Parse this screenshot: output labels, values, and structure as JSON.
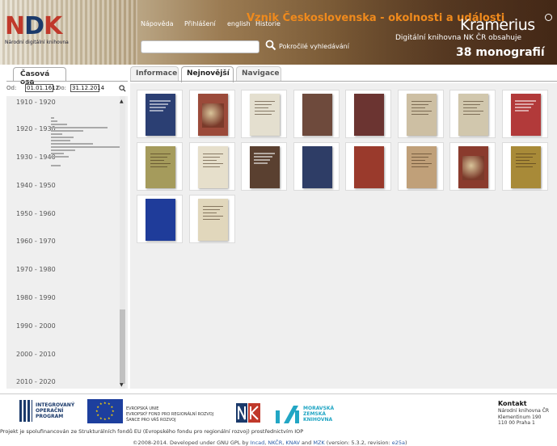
{
  "header": {
    "logo": {
      "mark_a": "N",
      "mark_b": "D",
      "mark_c": "K",
      "subtitle": "Národní digitální knihovna"
    },
    "links": {
      "help": "Nápověda",
      "login": "Přihlášení",
      "lang": "english",
      "history": "Historie"
    },
    "search": {
      "placeholder": "",
      "advanced": "Pokročilé vyhledávání"
    },
    "collection_title": "Vznik Československa - okolnosti a události",
    "app_name": "Kramerius",
    "library_contains": "Digitální knihovna NK ČR obsahuje",
    "monograph_count": "38 monografií"
  },
  "left": {
    "tab_label": "Časová osa",
    "date_from_label": "Od:",
    "date_from": "01.01.1612",
    "date_to_label": "Do:",
    "date_to": "31.12.2014",
    "decades": [
      "1910 - 1920",
      "1920 - 1930",
      "1930 - 1940",
      "1940 - 1950",
      "1950 - 1960",
      "1960 - 1970",
      "1970 - 1980",
      "1980 - 1990",
      "1990 - 2000",
      "2000 - 2010",
      "2010 - 2020"
    ]
  },
  "right": {
    "tabs": {
      "info": "Informace",
      "newest": "Nejnovější",
      "nav": "Navigace"
    },
    "active_tab": "Nejnovější",
    "covers": [
      {
        "color": "#2b3f73",
        "style": "title-light"
      },
      {
        "color": "#9b4a3a",
        "style": "picture"
      },
      {
        "color": "#e4dfcf",
        "style": "title-dark"
      },
      {
        "color": "#6e4a3c",
        "style": "plain"
      },
      {
        "color": "#6b3431",
        "style": "plain"
      },
      {
        "color": "#cdbfa3",
        "style": "title-dark"
      },
      {
        "color": "#d1c7ad",
        "style": "title-dark"
      },
      {
        "color": "#b23a3a",
        "style": "title-light"
      },
      {
        "color": "#a59b5c",
        "style": "title-dark"
      },
      {
        "color": "#e6dfcb",
        "style": "title-dark"
      },
      {
        "color": "#5a4030",
        "style": "title-light"
      },
      {
        "color": "#2e3d66",
        "style": "plain"
      },
      {
        "color": "#9a3a2c",
        "style": "plain"
      },
      {
        "color": "#c0a079",
        "style": "title-dark"
      },
      {
        "color": "#8a3b2d",
        "style": "picture"
      },
      {
        "color": "#a88a38",
        "style": "title-dark"
      },
      {
        "color": "#1f3c9a",
        "style": "plain"
      },
      {
        "color": "#e1d7bc",
        "style": "title-dark"
      }
    ]
  },
  "footer": {
    "eu_op": "INTEGROVANÝ OPERAČNÍ PROGRAM",
    "eu_text_1": "EVROPSKÁ UNIE",
    "eu_text_2": "EVROPSKÝ FOND PRO REGIONÁLNÍ ROZVOJ",
    "eu_text_3": "ŠANCE PRO VÁŠ ROZVOJ",
    "mzk_1": "MORAVSKÁ",
    "mzk_2": "ZEMSKÁ",
    "mzk_3": "KNIHOVNA",
    "contact_title": "Kontakt",
    "contact_1": "Národní knihovna ČR",
    "contact_2": "Klementinum 190",
    "contact_3": "110 00 Praha 1",
    "project": "Projekt je spolufinancován ze Strukturálních fondů EU (Evropského fondu pro regionální rozvoj) prostřednictvím IOP",
    "copy_a": "©2008-2014. Developed under GNU GPL by ",
    "copy_incad": "Incad",
    "copy_sep1": ", ",
    "copy_nkcr": "NKČR",
    "copy_sep2": ", ",
    "copy_knav": "KNAV",
    "copy_and": " and ",
    "copy_mzk": "MZK",
    "copy_version": " (version: 5.3.2, revision: ",
    "copy_rev": "e25a",
    "copy_end": ")"
  },
  "colors": {
    "accent_orange": "#f08a1c",
    "panel_bg": "#efefef",
    "link_blue": "#2d5ea8"
  }
}
